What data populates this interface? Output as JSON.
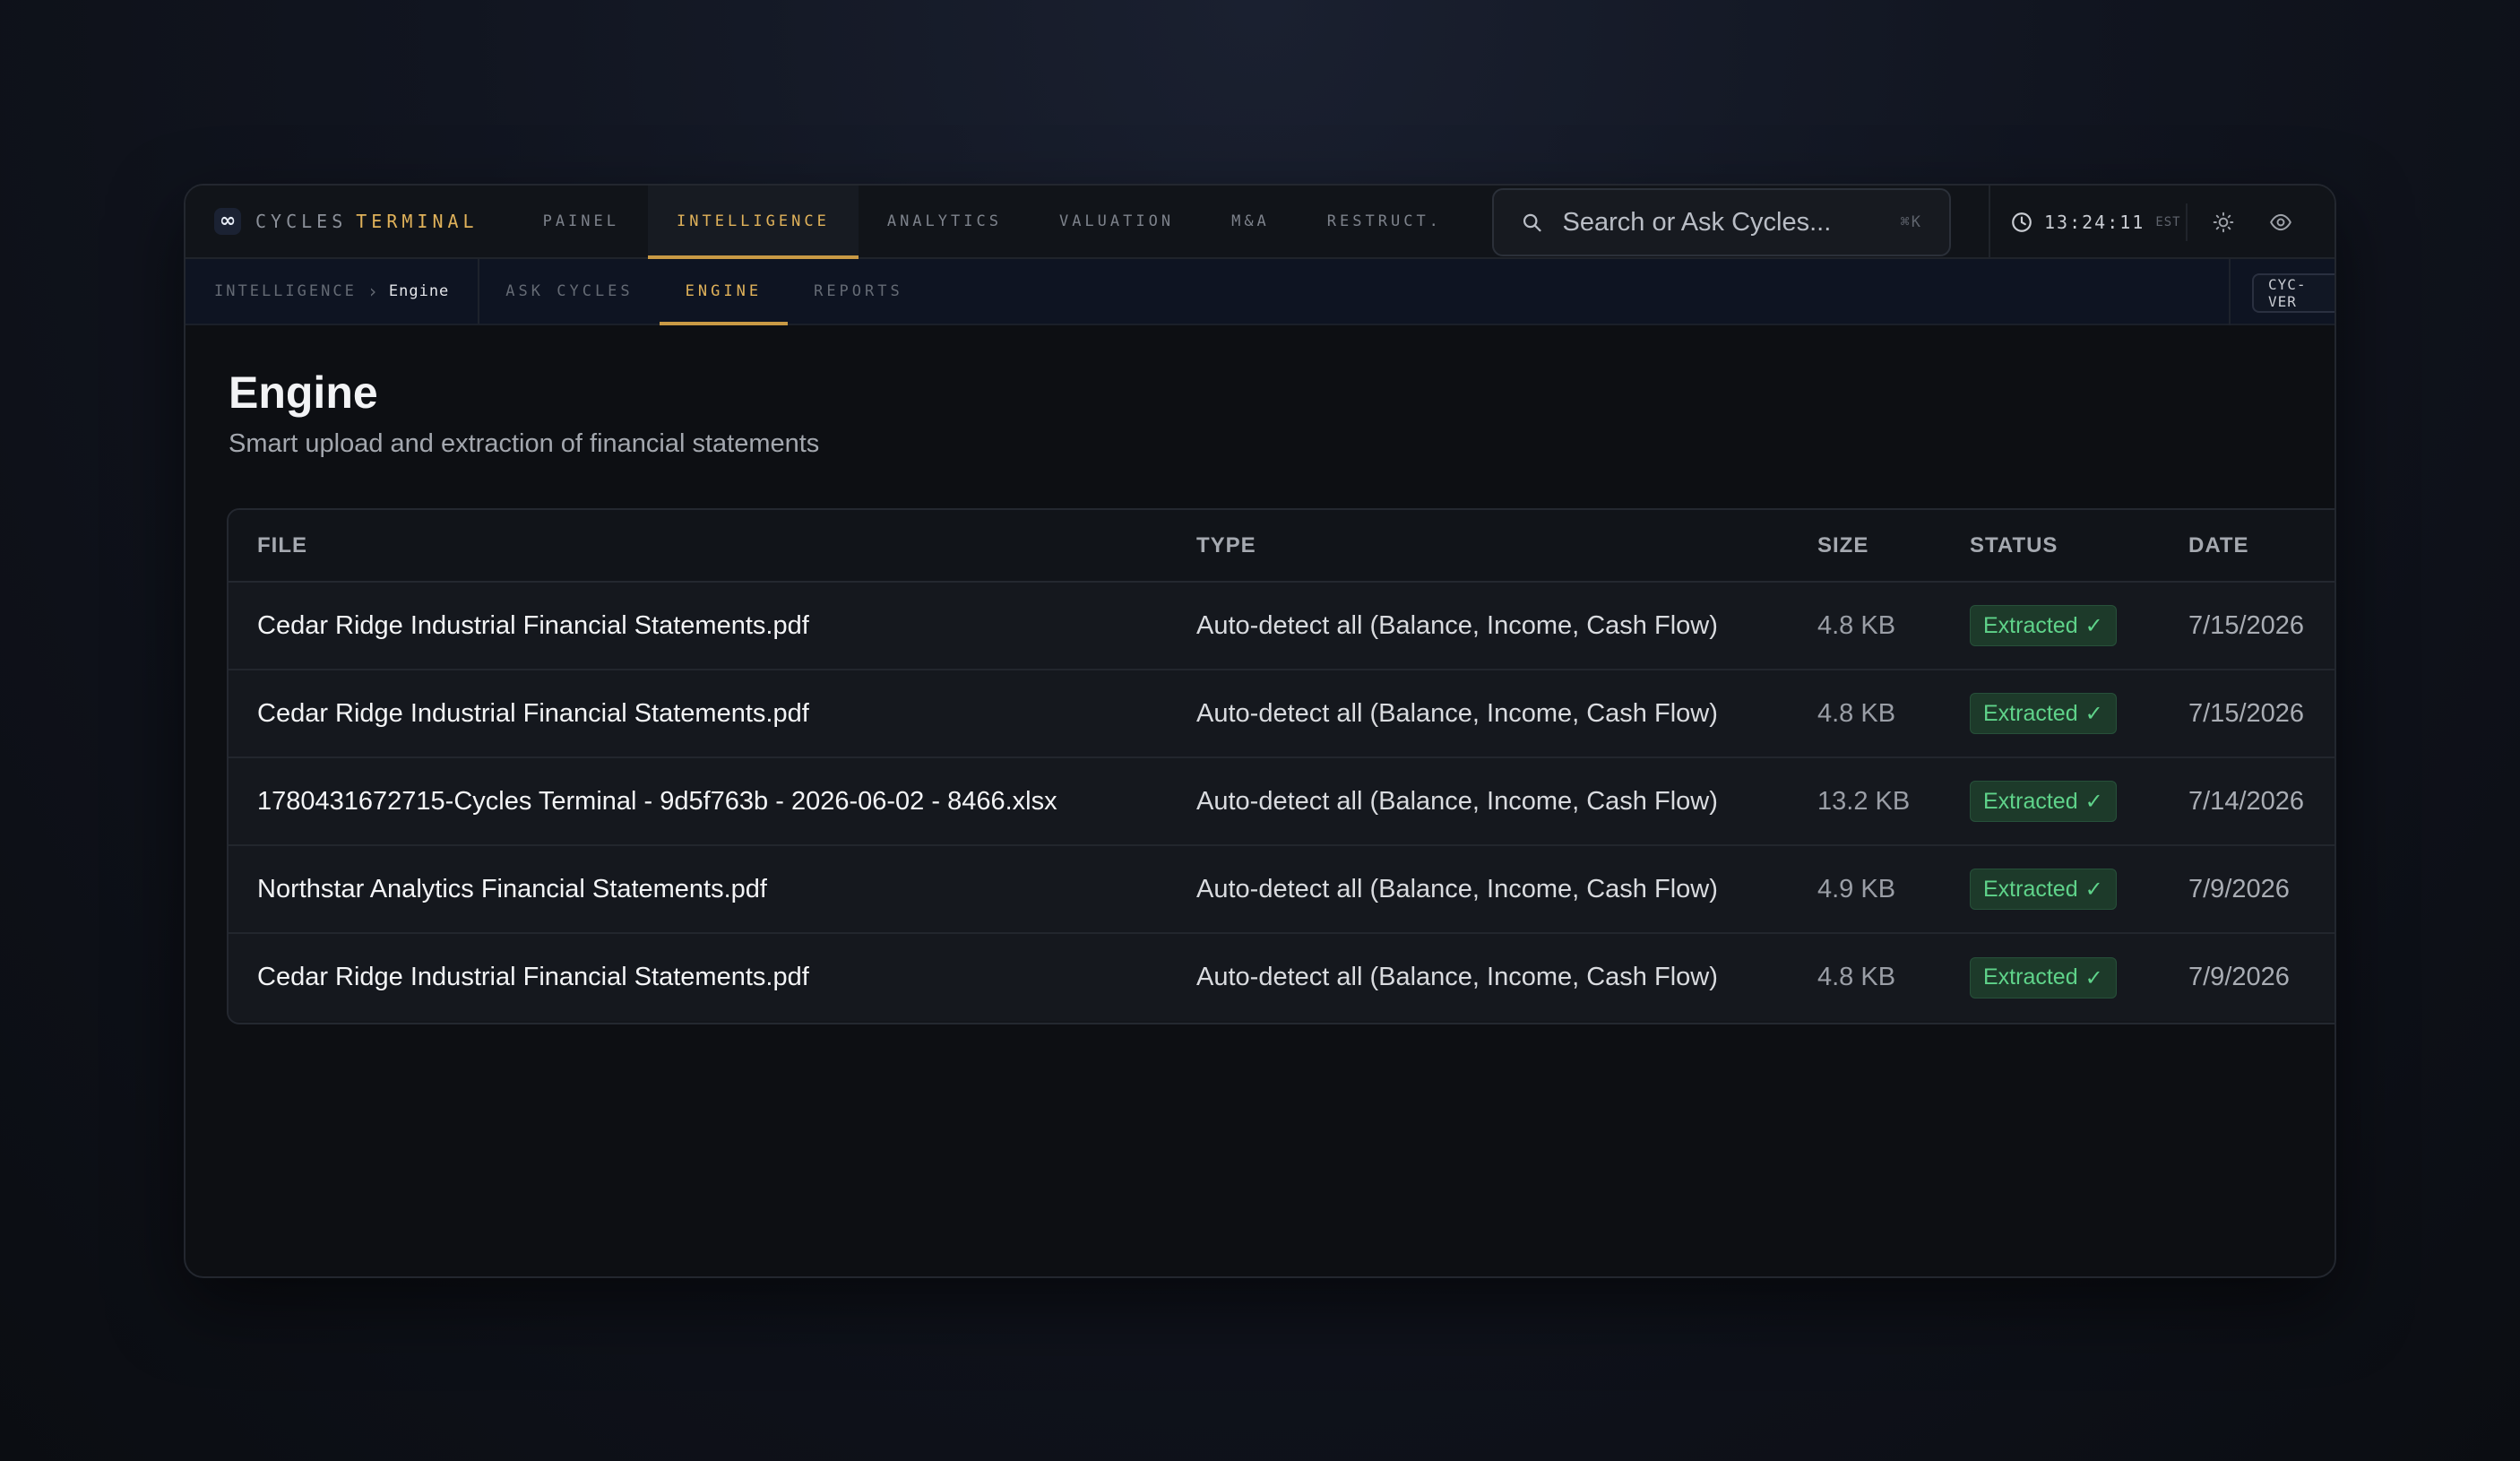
{
  "brand": {
    "logo_glyph": "∞",
    "name_part1": "CYCLES",
    "name_part2": "TERMINAL"
  },
  "nav": {
    "items": [
      {
        "label": "PAINEL",
        "active": false
      },
      {
        "label": "INTELLIGENCE",
        "active": true
      },
      {
        "label": "ANALYTICS",
        "active": false
      },
      {
        "label": "VALUATION",
        "active": false
      },
      {
        "label": "M&A",
        "active": false
      },
      {
        "label": "RESTRUCT.",
        "active": false
      }
    ]
  },
  "search": {
    "placeholder": "Search or Ask Cycles...",
    "shortcut": "⌘K",
    "icon": "search-icon"
  },
  "clock": {
    "time": "13:24:11",
    "timezone": "EST",
    "icon": "clock-icon"
  },
  "toolbar": {
    "theme_icon": "sun-icon",
    "visibility_icon": "eye-icon"
  },
  "breadcrumb": {
    "root": "INTELLIGENCE",
    "separator": "›",
    "current": "Engine"
  },
  "subnav": {
    "items": [
      {
        "label": "ASK CYCLES",
        "active": false
      },
      {
        "label": "ENGINE",
        "active": true
      },
      {
        "label": "REPORTS",
        "active": false
      }
    ]
  },
  "version": {
    "label": "CYC-VER"
  },
  "page": {
    "title": "Engine",
    "subtitle": "Smart upload and extraction of financial statements"
  },
  "table": {
    "columns": {
      "file": "FILE",
      "type": "TYPE",
      "size": "SIZE",
      "status": "STATUS",
      "date": "DATE"
    },
    "rows": [
      {
        "file": "Cedar Ridge Industrial Financial Statements.pdf",
        "type": "Auto-detect all (Balance, Income, Cash Flow)",
        "size": "4.8 KB",
        "status": "Extracted",
        "date": "7/15/2026"
      },
      {
        "file": "Cedar Ridge Industrial Financial Statements.pdf",
        "type": "Auto-detect all (Balance, Income, Cash Flow)",
        "size": "4.8 KB",
        "status": "Extracted",
        "date": "7/15/2026"
      },
      {
        "file": "1780431672715-Cycles Terminal - 9d5f763b - 2026-06-02 - 8466.xlsx",
        "type": "Auto-detect all (Balance, Income, Cash Flow)",
        "size": "13.2 KB",
        "status": "Extracted",
        "date": "7/14/2026"
      },
      {
        "file": "Northstar Analytics Financial Statements.pdf",
        "type": "Auto-detect all (Balance, Income, Cash Flow)",
        "size": "4.9 KB",
        "status": "Extracted",
        "date": "7/9/2026"
      },
      {
        "file": "Cedar Ridge Industrial Financial Statements.pdf",
        "type": "Auto-detect all (Balance, Income, Cash Flow)",
        "size": "4.8 KB",
        "status": "Extracted",
        "date": "7/9/2026"
      }
    ],
    "status_check_glyph": "✓"
  },
  "colors": {
    "accent": "#e0b25a",
    "status_success_text": "#5fd38a",
    "status_success_bg": "#1d3a2a",
    "background": "#0d0f13"
  }
}
